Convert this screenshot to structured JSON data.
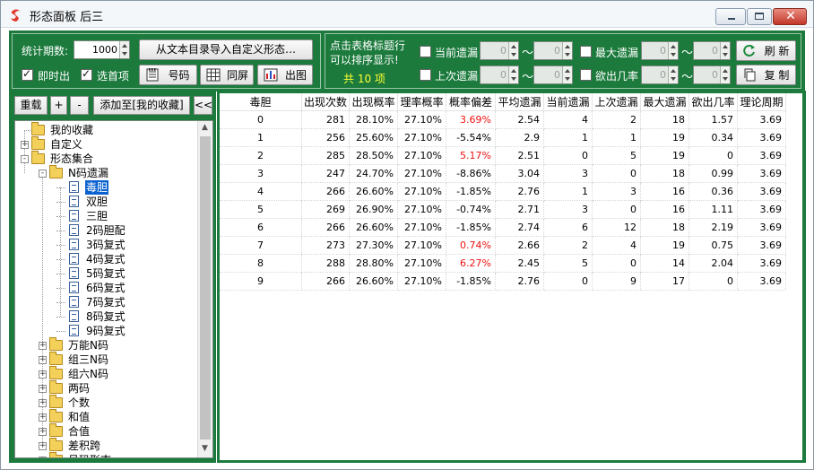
{
  "window": {
    "title": "形态面板 后三"
  },
  "controls": {
    "period_label": "统计期数:",
    "period_value": "1000",
    "import_button": "从文本目录导入自定义形态…",
    "realtime_label": "即时出",
    "realtime_checked": true,
    "first_label": "选首项",
    "first_checked": true,
    "number_button": "号码",
    "sameframe_button": "同屏",
    "chart_button": "出图",
    "tip_line1": "点击表格标题行",
    "tip_line2": "可以排序显示!",
    "count_text": "共 10 项",
    "current_miss_label": "当前遗漏",
    "last_miss_label": "上次遗漏",
    "max_miss_label": "最大遗漏",
    "desire_label": "欲出几率",
    "range_values": [
      "0",
      "0",
      "0",
      "0",
      "0",
      "0",
      "0",
      "0"
    ],
    "tilde": "～",
    "refresh_button": "刷 新",
    "copy_button": "复 制"
  },
  "left": {
    "reload_button": "重载",
    "plus_button": "+",
    "minus_button": "-",
    "add_fav_button": "添加至[我的收藏]",
    "collapse_button": "<<"
  },
  "tree": [
    {
      "label": "我的收藏",
      "level": 0,
      "type": "folder",
      "expander": ""
    },
    {
      "label": "自定义",
      "level": 0,
      "type": "folder",
      "expander": "+"
    },
    {
      "label": "形态集合",
      "level": 0,
      "type": "folder-open",
      "expander": "-"
    },
    {
      "label": "N码遗漏",
      "level": 1,
      "type": "folder-open",
      "expander": "-"
    },
    {
      "label": "毒胆",
      "level": 2,
      "type": "doc",
      "selected": true
    },
    {
      "label": "双胆",
      "level": 2,
      "type": "doc"
    },
    {
      "label": "三胆",
      "level": 2,
      "type": "doc"
    },
    {
      "label": "2码胆配",
      "level": 2,
      "type": "doc"
    },
    {
      "label": "3码复式",
      "level": 2,
      "type": "doc"
    },
    {
      "label": "4码复式",
      "level": 2,
      "type": "doc"
    },
    {
      "label": "5码复式",
      "level": 2,
      "type": "doc"
    },
    {
      "label": "6码复式",
      "level": 2,
      "type": "doc"
    },
    {
      "label": "7码复式",
      "level": 2,
      "type": "doc"
    },
    {
      "label": "8码复式",
      "level": 2,
      "type": "doc"
    },
    {
      "label": "9码复式",
      "level": 2,
      "type": "doc"
    },
    {
      "label": "万能N码",
      "level": 1,
      "type": "folder",
      "expander": "+"
    },
    {
      "label": "组三N码",
      "level": 1,
      "type": "folder",
      "expander": "+"
    },
    {
      "label": "组六N码",
      "level": 1,
      "type": "folder",
      "expander": "+"
    },
    {
      "label": "两码",
      "level": 1,
      "type": "folder",
      "expander": "+"
    },
    {
      "label": "个数",
      "level": 1,
      "type": "folder",
      "expander": "+"
    },
    {
      "label": "和值",
      "level": 1,
      "type": "folder",
      "expander": "+"
    },
    {
      "label": "合值",
      "level": 1,
      "type": "folder",
      "expander": "+"
    },
    {
      "label": "差积跨",
      "level": 1,
      "type": "folder",
      "expander": "+"
    },
    {
      "label": "号码形态",
      "level": 1,
      "type": "folder",
      "expander": "+"
    }
  ],
  "table": {
    "columns": [
      "毒胆",
      "出现次数",
      "出现概率",
      "理率概率",
      "概率偏差",
      "平均遗漏",
      "当前遗漏",
      "上次遗漏",
      "最大遗漏",
      "欲出几率",
      "理论周期"
    ],
    "rows": [
      [
        "0",
        "281",
        "28.10%",
        "27.10%",
        "3.69%",
        "2.54",
        "4",
        "2",
        "18",
        "1.57",
        "3.69"
      ],
      [
        "1",
        "256",
        "25.60%",
        "27.10%",
        "-5.54%",
        "2.9",
        "1",
        "1",
        "19",
        "0.34",
        "3.69"
      ],
      [
        "2",
        "285",
        "28.50%",
        "27.10%",
        "5.17%",
        "2.51",
        "0",
        "5",
        "19",
        "0",
        "3.69"
      ],
      [
        "3",
        "247",
        "24.70%",
        "27.10%",
        "-8.86%",
        "3.04",
        "3",
        "0",
        "18",
        "0.99",
        "3.69"
      ],
      [
        "4",
        "266",
        "26.60%",
        "27.10%",
        "-1.85%",
        "2.76",
        "1",
        "3",
        "16",
        "0.36",
        "3.69"
      ],
      [
        "5",
        "269",
        "26.90%",
        "27.10%",
        "-0.74%",
        "2.71",
        "3",
        "0",
        "16",
        "1.11",
        "3.69"
      ],
      [
        "6",
        "266",
        "26.60%",
        "27.10%",
        "-1.85%",
        "2.74",
        "6",
        "12",
        "18",
        "2.19",
        "3.69"
      ],
      [
        "7",
        "273",
        "27.30%",
        "27.10%",
        "0.74%",
        "2.66",
        "2",
        "4",
        "19",
        "0.75",
        "3.69"
      ],
      [
        "8",
        "288",
        "28.80%",
        "27.10%",
        "6.27%",
        "2.45",
        "5",
        "0",
        "14",
        "2.04",
        "3.69"
      ],
      [
        "9",
        "266",
        "26.60%",
        "27.10%",
        "-1.85%",
        "2.76",
        "0",
        "9",
        "17",
        "0",
        "3.69"
      ]
    ],
    "positive_deviation_color": "#ee1111"
  },
  "icons": {
    "app": "red-swirl-icon",
    "number": "notepad-icon",
    "sameframe": "grid-icon",
    "chart": "bar-chart-icon",
    "refresh": "refresh-icon",
    "copy": "copy-icon"
  }
}
